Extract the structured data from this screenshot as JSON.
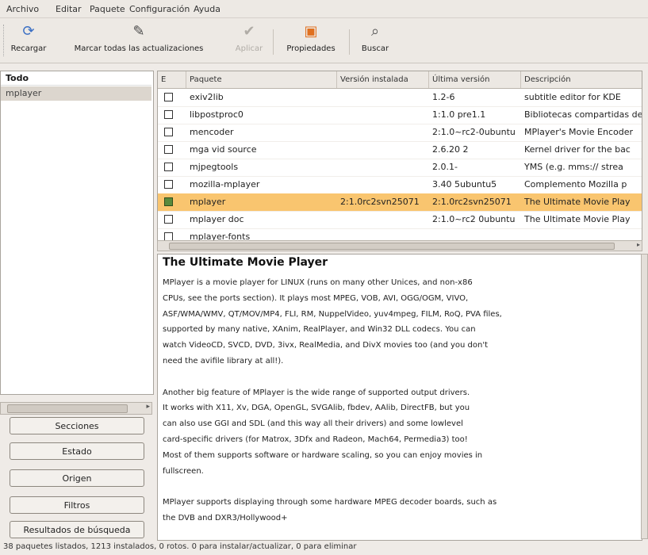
{
  "menubar": [
    "Archivo",
    "Editar",
    "Paquete",
    "Configuración",
    "Ayuda"
  ],
  "toolbar": {
    "reload": "Recargar",
    "mark_all": "Marcar todas las actualizaciones",
    "apply": "Aplicar",
    "properties": "Propiedades",
    "search": "Buscar"
  },
  "left": {
    "header": "Todo",
    "selected": "mplayer",
    "buttons": [
      "Secciones",
      "Estado",
      "Origen",
      "Filtros",
      "Resultados de búsqueda"
    ]
  },
  "table": {
    "headers": [
      "E",
      "Paquete",
      "Versión instalada",
      "Última versión",
      "Descripción"
    ],
    "rows": [
      {
        "name": "exiv2lib",
        "installed": "",
        "latest": "1.2-6",
        "desc": "subtitle editor for KDE",
        "selected": false
      },
      {
        "name": "libpostproc0",
        "installed": "",
        "latest": "1:1.0 pre1.1",
        "desc": "Bibliotecas compartidas de",
        "selected": false
      },
      {
        "name": "mencoder",
        "installed": "",
        "latest": "2:1.0~rc2-0ubuntu",
        "desc": "MPlayer's Movie Encoder",
        "selected": false
      },
      {
        "name": "mga vid source",
        "installed": "",
        "latest": "2.6.20 2",
        "desc": "Kernel driver for the bac",
        "selected": false
      },
      {
        "name": "mjpegtools",
        "installed": "",
        "latest": "2.0.1-",
        "desc": "YMS (e.g. mms:// strea",
        "selected": false
      },
      {
        "name": "mozilla-mplayer",
        "installed": "",
        "latest": "3.40 5ubuntu5",
        "desc": "Complemento Mozilla p",
        "selected": false
      },
      {
        "name": "mplayer",
        "installed": "2:1.0rc2svn25071",
        "latest": "2:1.0rc2svn25071",
        "desc": "The Ultimate Movie Play",
        "selected": true
      },
      {
        "name": "mplayer doc",
        "installed": "",
        "latest": "2:1.0~rc2 0ubuntu",
        "desc": "The Ultimate Movie Play",
        "selected": false
      },
      {
        "name": "mplayer-fonts",
        "installed": "",
        "latest": "",
        "desc": "",
        "selected": false
      }
    ]
  },
  "description": {
    "title": "The Ultimate Movie Player",
    "p1": [
      "MPlayer is a movie player for LINUX (runs on many other Unices, and non-x86",
      "CPUs, see the ports section). It plays most MPEG, VOB, AVI, OGG/OGM, VIVO,",
      "ASF/WMA/WMV, QT/MOV/MP4, FLI, RM, NuppelVideo, yuv4mpeg, FILM, RoQ, PVA files,",
      "supported by many native, XAnim, RealPlayer, and Win32 DLL codecs. You can",
      "watch VideoCD, SVCD, DVD, 3ivx, RealMedia, and DivX movies too (and you don't",
      "need the avifile library at all!)."
    ],
    "p2": [
      "Another big feature of MPlayer is the wide range of supported output drivers.",
      "It works with X11, Xv, DGA, OpenGL, SVGAlib, fbdev, AAlib, DirectFB, but you",
      "can also use GGI and SDL (and this way all their drivers) and some lowlevel",
      "card-specific drivers (for Matrox, 3Dfx and Radeon, Mach64, Permedia3) too!",
      "Most of them supports software or hardware scaling, so you can enjoy movies in",
      "fullscreen."
    ],
    "p3": [
      "MPlayer supports displaying through some hardware MPEG decoder boards, such as",
      "the DVB and DXR3/Hollywood+"
    ]
  },
  "status": "38 paquetes listados, 1213 instalados, 0 rotos. 0 para instalar/actualizar, 0 para eliminar"
}
